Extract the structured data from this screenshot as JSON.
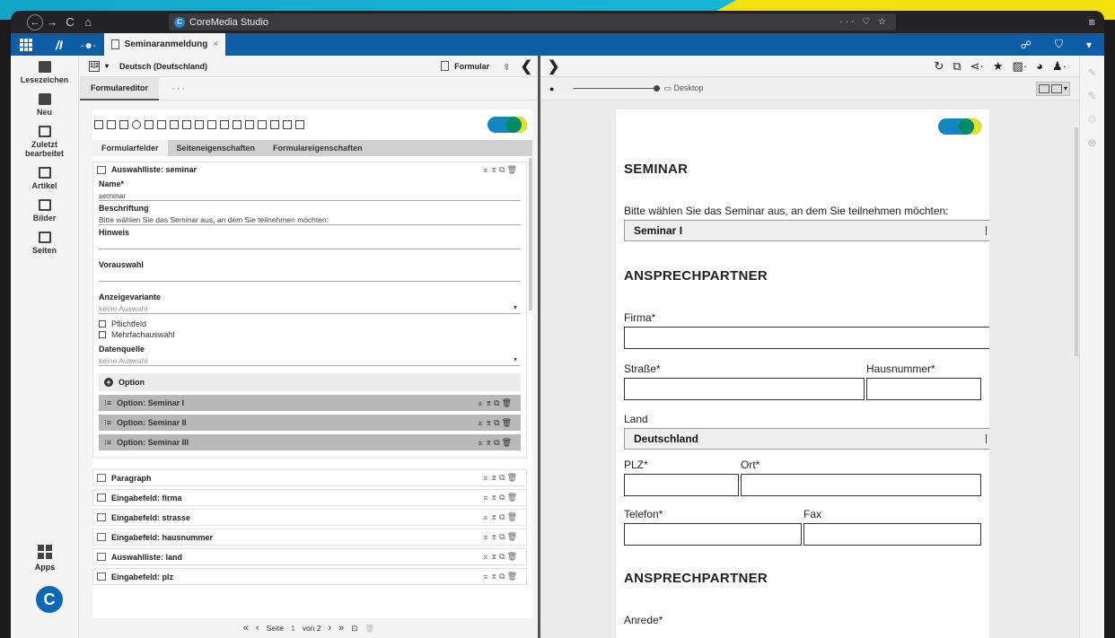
{
  "browser": {
    "tab_title": "CoreMedia Studio",
    "nav": [
      "←",
      "→",
      "C",
      "⌂"
    ],
    "url_right": "··· ♡ ☆",
    "menu": "≡"
  },
  "app": {
    "logo": "/I",
    "library_icon": "·●·",
    "tab_label": "Seminaranmeldung",
    "tab_close": "×",
    "right_icons": [
      "☍",
      "⛉",
      "▾"
    ]
  },
  "sidebar": {
    "items": [
      {
        "label": "Lesezeichen",
        "icon": "bookmark-icon"
      },
      {
        "label": "Neu",
        "icon": "new-doc-icon"
      },
      {
        "label": "Zuletzt bearbeitet",
        "icon": "recent-icon"
      },
      {
        "label": "Artikel",
        "icon": "article-icon"
      },
      {
        "label": "Bilder",
        "icon": "image-icon"
      },
      {
        "label": "Seiten",
        "icon": "page-icon"
      }
    ],
    "apps_label": "Apps"
  },
  "toolbar": {
    "lang_icon": "1|2",
    "language": "Deutsch (Deutschland)",
    "form_label": "Formular",
    "bulb": "♀",
    "collapse": "❮"
  },
  "editor": {
    "subtab": "Formulareditor",
    "more": "···",
    "form_tabs": [
      "Formularfelder",
      "Seiteneigenschaften",
      "Formulareigenschaften"
    ],
    "field_title": "Auswahlliste: seminar",
    "props": {
      "name_label": "Name*",
      "name_value": "seminar",
      "caption_label": "Beschriftung",
      "caption_value": "Bitte wählen Sie das Seminar aus, an dem Sie teilnehmen möchten:",
      "hint_label": "Hinweis",
      "hint_value": "",
      "preselect_label": "Vorauswahl",
      "preselect_value": "",
      "variant_label": "Anzeigevariante",
      "variant_value": "keine Auswahl",
      "required_label": "Pflichtfeld",
      "multi_label": "Mehrfachauswahl",
      "source_label": "Datenquelle",
      "source_value": "keine Auswahl"
    },
    "add_option": "Option",
    "options": [
      "Option: Seminar I",
      "Option: Seminar II",
      "Option: Seminar III"
    ],
    "fields": [
      "Paragraph",
      "Eingabefeld: firma",
      "Eingabefeld: strasse",
      "Eingabefeld: hausnummer",
      "Auswahlliste: land",
      "Eingabefeld: plz"
    ],
    "row_actions": "⌅⌆⧉🗑"
  },
  "pager": {
    "first": "«",
    "prev": "‹",
    "page_label": "Seite",
    "page": "1",
    "of_label": "von 2",
    "next": "›",
    "last": "»"
  },
  "preview_bar": {
    "expand": "❯",
    "device_label": "Desktop",
    "tools": [
      "↻",
      "⧉",
      "⋖·",
      "★",
      "▨·",
      "◕",
      "♟·"
    ]
  },
  "preview": {
    "h_seminar": "SEMINAR",
    "seminar_question": "Bitte wählen Sie das Seminar aus, an dem Sie teilnehmen möchten:",
    "seminar_selected": "Seminar I",
    "h_contact": "ANSPRECHPARTNER",
    "firma": "Firma*",
    "strasse": "Straße*",
    "hausnummer": "Hausnummer*",
    "land": "Land",
    "land_selected": "Deutschland",
    "plz": "PLZ*",
    "ort": "Ort*",
    "telefon": "Telefon*",
    "fax": "Fax",
    "h_contact2": "ANSPRECHPARTNER",
    "anrede": "Anrede*"
  },
  "colors": {
    "app_bar": "#0d5da6",
    "toggle_blue": "#1286c2",
    "toggle_yellow": "#e8e21a",
    "toggle_green": "#078a6a"
  }
}
